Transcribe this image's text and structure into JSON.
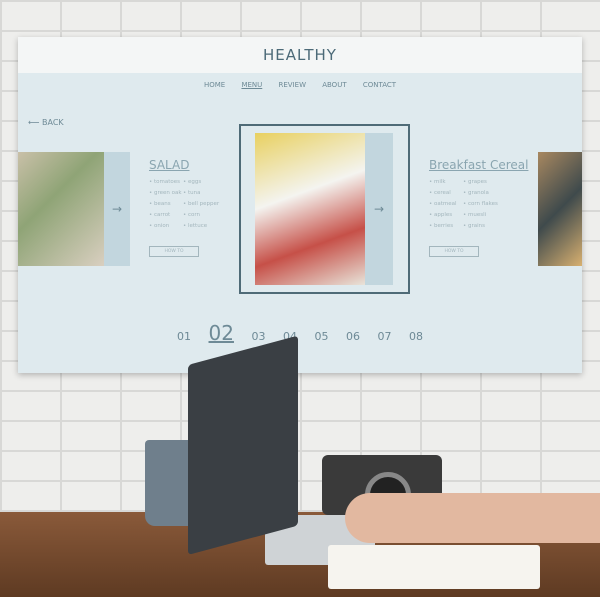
{
  "header": {
    "title": "HEALTHY"
  },
  "nav": {
    "items": [
      "HOME",
      "MENU",
      "REVIEW",
      "ABOUT",
      "CONTACT"
    ],
    "active": "MENU"
  },
  "back": {
    "label": "BACK",
    "icon": "arrow-left-icon"
  },
  "cards": [
    {
      "title": "SALAD",
      "items": [
        "tomatoes",
        "eggs",
        "green oak",
        "tuna",
        "beans",
        "bell pepper",
        "carrot",
        "corn",
        "onion",
        "lettuce"
      ],
      "button": "HOW TO"
    },
    {
      "title": "Breakfast Cereal",
      "items": [
        "milk",
        "grapes",
        "cereal",
        "granola",
        "oatmeal",
        "corn flakes",
        "apples",
        "muesli",
        "berries",
        "grains"
      ],
      "button": "HOW TO"
    }
  ],
  "pagination": {
    "pages": [
      "01",
      "02",
      "03",
      "04",
      "05",
      "06",
      "07",
      "08"
    ],
    "current": "02"
  },
  "colors": {
    "accent": "#4f6b77",
    "screen_bg": "#dfeaee",
    "strip": "#c2d6de"
  }
}
